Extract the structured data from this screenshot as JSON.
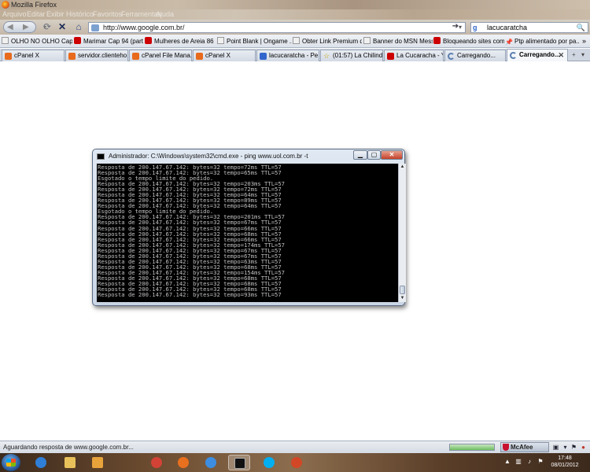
{
  "window": {
    "title": "Mozilla Firefox"
  },
  "menu": [
    "Arquivo",
    "Editar",
    "Exibir",
    "Histórico",
    "Favoritos",
    "Ferramentas",
    "Ajuda"
  ],
  "nav": {
    "url": "http://www.google.com.br/",
    "search_engine": "Google",
    "search_query": "lacucaratcha"
  },
  "bookmarks": [
    {
      "label": "OLHO NO OLHO Capi...",
      "icon": "page-icon"
    },
    {
      "label": "Marimar Cap 94 (parte...",
      "icon": "youtube-icon"
    },
    {
      "label": "Mulheres de Areia 86 -...",
      "icon": "youtube-icon"
    },
    {
      "label": "Point Blank | Ongame ...",
      "icon": "page-icon"
    },
    {
      "label": "Obter Link Premium d...",
      "icon": "page-icon"
    },
    {
      "label": "Banner do MSN Messe...",
      "icon": "page-icon"
    },
    {
      "label": "Bloqueando sites com ...",
      "icon": "youtube-icon"
    },
    {
      "label": "Ptp alimentado por pa...",
      "icon": "pin-icon"
    }
  ],
  "tabs": [
    {
      "label": "cPanel X",
      "active": false
    },
    {
      "label": "servidor.clienteho...",
      "active": false
    },
    {
      "label": "cPanel File Mana...",
      "active": false
    },
    {
      "label": "cPanel X",
      "active": false
    },
    {
      "label": "lacucaratcha - Pe...",
      "active": false
    },
    {
      "label": "(01:57) La Chilindr...",
      "active": false
    },
    {
      "label": "La Cucaracha - Y...",
      "active": false
    },
    {
      "label": "Carregando...",
      "active": false
    },
    {
      "label": "Carregando...",
      "active": true
    }
  ],
  "console": {
    "title": "Administrador: C:\\Windows\\system32\\cmd.exe - ping  www.uol.com.br -t",
    "lines": [
      "Resposta de 200.147.67.142: bytes=32 tempo=72ms TTL=57",
      "Resposta de 200.147.67.142: bytes=32 tempo=65ms TTL=57",
      "Esgotado o tempo limite do pedido.",
      "Resposta de 200.147.67.142: bytes=32 tempo=203ms TTL=57",
      "Resposta de 200.147.67.142: bytes=32 tempo=72ms TTL=57",
      "Resposta de 200.147.67.142: bytes=32 tempo=64ms TTL=57",
      "Resposta de 200.147.67.142: bytes=32 tempo=89ms TTL=57",
      "Resposta de 200.147.67.142: bytes=32 tempo=64ms TTL=57",
      "Esgotado o tempo limite do pedido.",
      "Resposta de 200.147.67.142: bytes=32 tempo=201ms TTL=57",
      "Resposta de 200.147.67.142: bytes=32 tempo=67ms TTL=57",
      "Resposta de 200.147.67.142: bytes=32 tempo=66ms TTL=57",
      "Resposta de 200.147.67.142: bytes=32 tempo=68ms TTL=57",
      "Resposta de 200.147.67.142: bytes=32 tempo=66ms TTL=57",
      "Resposta de 200.147.67.142: bytes=32 tempo=174ms TTL=57",
      "Resposta de 200.147.67.142: bytes=32 tempo=67ms TTL=57",
      "Resposta de 200.147.67.142: bytes=32 tempo=67ms TTL=57",
      "Resposta de 200.147.67.142: bytes=32 tempo=63ms TTL=57",
      "Resposta de 200.147.67.142: bytes=32 tempo=68ms TTL=57",
      "Resposta de 200.147.67.142: bytes=32 tempo=154ms TTL=57",
      "Resposta de 200.147.67.142: bytes=32 tempo=68ms TTL=57",
      "Resposta de 200.147.67.142: bytes=32 tempo=68ms TTL=57",
      "Resposta de 200.147.67.142: bytes=32 tempo=68ms TTL=57",
      "Resposta de 200.147.67.142: bytes=32 tempo=93ms TTL=57"
    ]
  },
  "status": {
    "text": "Aguardando resposta de www.google.com.br...",
    "progress": 1.0,
    "mcafee": "McAfee"
  },
  "taskbar": {
    "apps": [
      {
        "name": "internet-explorer-icon",
        "color": "#2f7fd8"
      },
      {
        "name": "explorer-folder-icon",
        "color": "#e8c15a"
      },
      {
        "name": "media-player-icon",
        "color": "#e8a33a"
      },
      {
        "name": "chrome-icon",
        "color": "#d44236"
      },
      {
        "name": "firefox-icon",
        "color": "#e8701e"
      },
      {
        "name": "msn-messenger-icon",
        "color": "#3d8ee0"
      },
      {
        "name": "cmd-icon",
        "color": "#111111"
      },
      {
        "name": "skype-icon",
        "color": "#00aff0"
      },
      {
        "name": "powerpoint-icon",
        "color": "#d24726"
      }
    ],
    "time": "17:48",
    "date": "08/01/2012"
  }
}
